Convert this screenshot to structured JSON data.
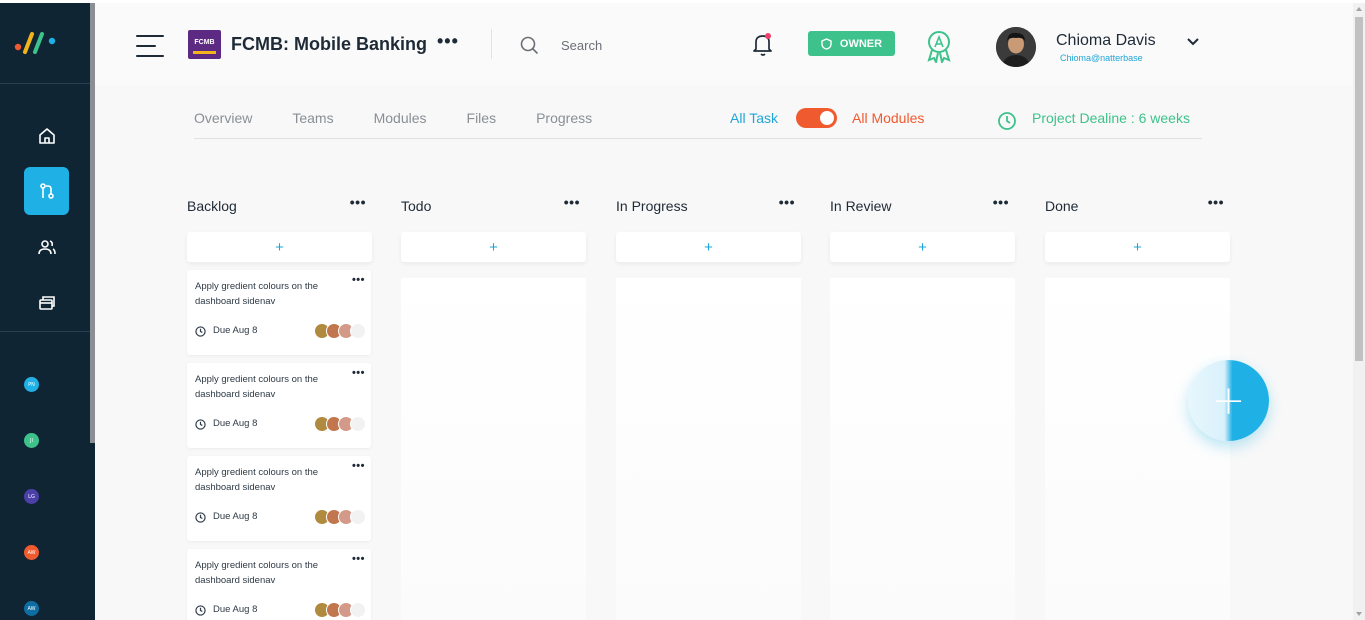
{
  "header": {
    "project_logo_text": "FCMB",
    "project_title": "FCMB: Mobile Banking",
    "project_more": "•••",
    "search_placeholder": "Search",
    "role_badge": "OWNER",
    "user_name": "Chioma Davis",
    "user_email": "Chioma@natterbase"
  },
  "sidebar": {
    "nav": [
      {
        "icon": "home-icon"
      },
      {
        "icon": "git-pull-request-icon",
        "active": true
      },
      {
        "icon": "users-icon"
      },
      {
        "icon": "folders-icon"
      }
    ],
    "projects": [
      {
        "initials": "PN",
        "color": "#1fb0e6"
      },
      {
        "initials": "JI",
        "color": "#3ec28c"
      },
      {
        "initials": "LG",
        "color": "#4b3fa8"
      },
      {
        "initials": "AW",
        "color": "#f05a2f"
      },
      {
        "initials": "AW",
        "color": "#0e6ea3"
      }
    ]
  },
  "tabs": [
    "Overview",
    "Teams",
    "Modules",
    "Files",
    "Progress"
  ],
  "filters": {
    "all_task": "All Task",
    "all_modules": "All Modules",
    "toggle_on": true,
    "deadline": "Project Dealine : 6 weeks"
  },
  "board": {
    "add_symbol": "+",
    "more_symbol": "•••",
    "columns": [
      "Backlog",
      "Todo",
      "In Progress",
      "In Review",
      "Done"
    ],
    "tasks": [
      {
        "title": "Apply gredient colours on the dashboard sidenav",
        "due": "Due Aug 8"
      },
      {
        "title": "Apply gredient colours on the dashboard sidenav",
        "due": "Due Aug 8"
      },
      {
        "title": "Apply gredient colours on the dashboard sidenav",
        "due": "Due Aug 8"
      },
      {
        "title": "Apply gredient colours on the dashboard sidenav",
        "due": "Due Aug 8"
      }
    ]
  },
  "fab": {
    "symbol": "+"
  },
  "colors": {
    "sidebar": "#0f2533",
    "accent_blue": "#1fb0e6",
    "accent_green": "#3ec28c",
    "accent_orange": "#f05a2f",
    "project_purple": "#5c2a83"
  }
}
